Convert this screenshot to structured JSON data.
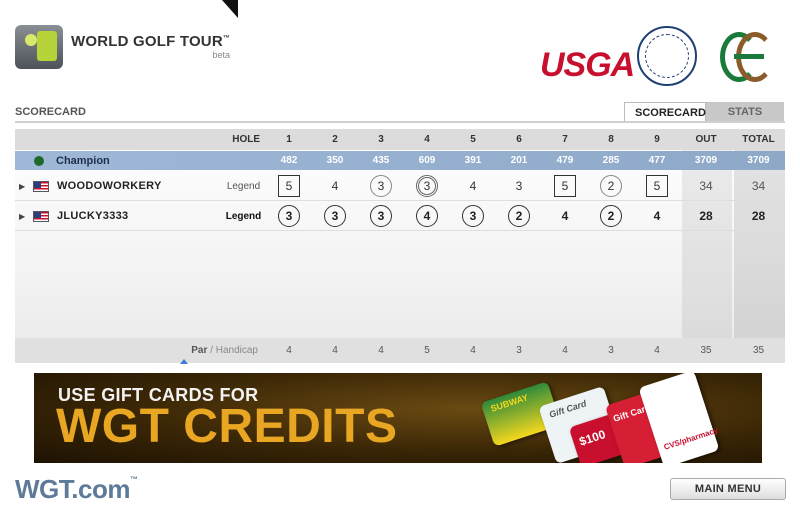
{
  "brand": {
    "title": "WORLD GOLF TOUR",
    "tm": "™",
    "sub": "beta",
    "sponsor": "USGA",
    "footer_logo": "WGT.com",
    "footer_tm": "™"
  },
  "scorecard": {
    "title": "SCORECARD",
    "tabs": [
      {
        "label": "SCORECARD",
        "active": true
      },
      {
        "label": "STATS",
        "active": false
      }
    ]
  },
  "table": {
    "hole_label": "HOLE",
    "holes": [
      "1",
      "2",
      "3",
      "4",
      "5",
      "6",
      "7",
      "8",
      "9"
    ],
    "out_label": "OUT",
    "total_label": "TOTAL",
    "champion": {
      "name": "Champion",
      "yardages": [
        "482",
        "350",
        "435",
        "609",
        "391",
        "201",
        "479",
        "285",
        "477"
      ],
      "out": "3709",
      "total": "3709"
    },
    "players": [
      {
        "name": "WOODOWORKERY",
        "level": "Legend",
        "scores": [
          "5",
          "4",
          "3",
          "3",
          "4",
          "3",
          "5",
          "2",
          "5"
        ],
        "marks": [
          "square",
          "plain",
          "circle",
          "dcircle",
          "plain",
          "plain",
          "square",
          "circle",
          "square"
        ],
        "out": "34",
        "total": "34"
      },
      {
        "name": "JLUCKY3333",
        "level": "Legend",
        "scores": [
          "3",
          "3",
          "3",
          "4",
          "3",
          "2",
          "4",
          "2",
          "4"
        ],
        "marks": [
          "circle",
          "circle",
          "circle",
          "circle",
          "circle",
          "circle",
          "plain",
          "circle",
          "plain"
        ],
        "out": "28",
        "total": "28"
      }
    ],
    "par": {
      "label_par": "Par",
      "label_sep": " / ",
      "label_handicap": "Handicap",
      "values": [
        "4",
        "4",
        "4",
        "5",
        "4",
        "3",
        "4",
        "3",
        "4"
      ],
      "out": "35",
      "total": "35"
    }
  },
  "banner": {
    "line1": "USE GIFT CARDS FOR",
    "line2": "WGT CREDITS",
    "card_subway": "SUBWAY",
    "card_gift": "Gift Card",
    "card_100": "$100",
    "card_gift2": "Gift Card",
    "card_cvs": "CVS/pharmacy"
  },
  "buttons": {
    "main_menu": "MAIN MENU"
  }
}
